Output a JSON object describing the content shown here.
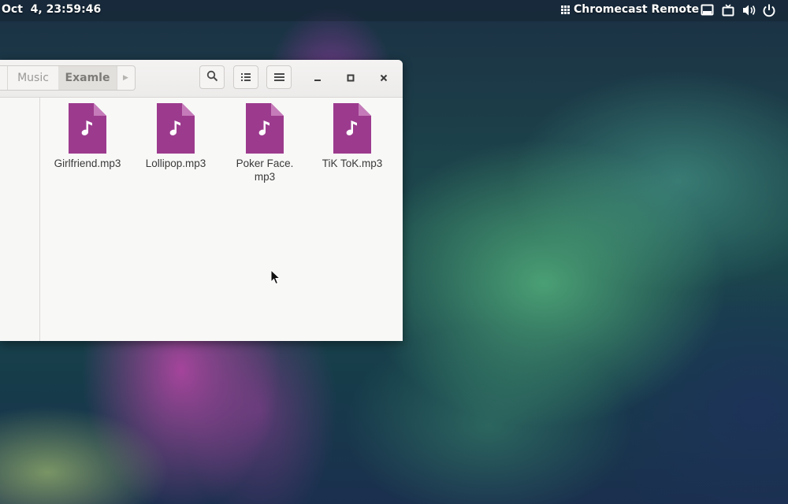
{
  "top_panel": {
    "clock": "Oct  4, 23:59:46",
    "app_indicator": "Chromecast Remote",
    "tray_icons": [
      "screen-icon",
      "tv-icon",
      "volume-icon",
      "power-icon"
    ]
  },
  "file_manager": {
    "breadcrumbs": [
      "Music",
      "Examle"
    ],
    "files": [
      {
        "name": "Girlfriend.mp3",
        "icon": "audio-file-icon"
      },
      {
        "name": "Lollipop.mp3",
        "icon": "audio-file-icon"
      },
      {
        "name": "Poker Face.\nmp3",
        "icon": "audio-file-icon"
      },
      {
        "name": "TiK ToK.mp3",
        "icon": "audio-file-icon"
      }
    ]
  },
  "colors": {
    "file_icon": "#9c3b8e",
    "file_icon_fold": "#c57bb9"
  }
}
